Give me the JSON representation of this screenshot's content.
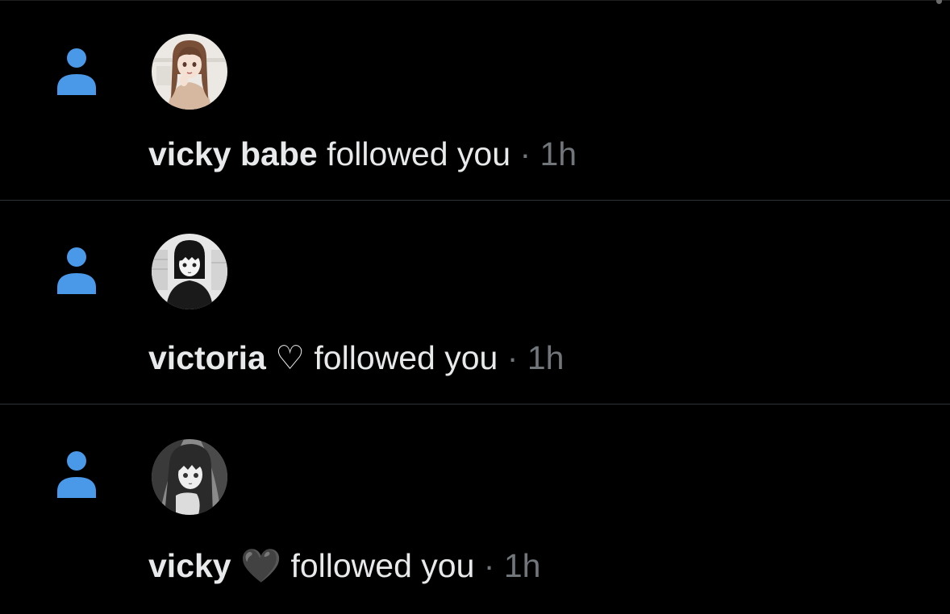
{
  "colors": {
    "background": "#000000",
    "accent": "#4a99e9",
    "text": "#e7e9ea",
    "muted": "#71767b",
    "divider": "#2f3336"
  },
  "notifications": [
    {
      "type_icon": "person-icon",
      "avatar": "avatar-brown-hair-anime-girl",
      "user_name": "vicky babe",
      "action": "followed you",
      "separator": "·",
      "time": "1h"
    },
    {
      "type_icon": "person-icon",
      "avatar": "avatar-black-hair-anime-girl",
      "user_name": "victoria ♡",
      "action": "followed you",
      "separator": "·",
      "time": "1h"
    },
    {
      "type_icon": "person-icon",
      "avatar": "avatar-monochrome-anime-girl",
      "user_name": "vicky 🖤",
      "action": "followed you",
      "separator": "·",
      "time": "1h"
    }
  ]
}
